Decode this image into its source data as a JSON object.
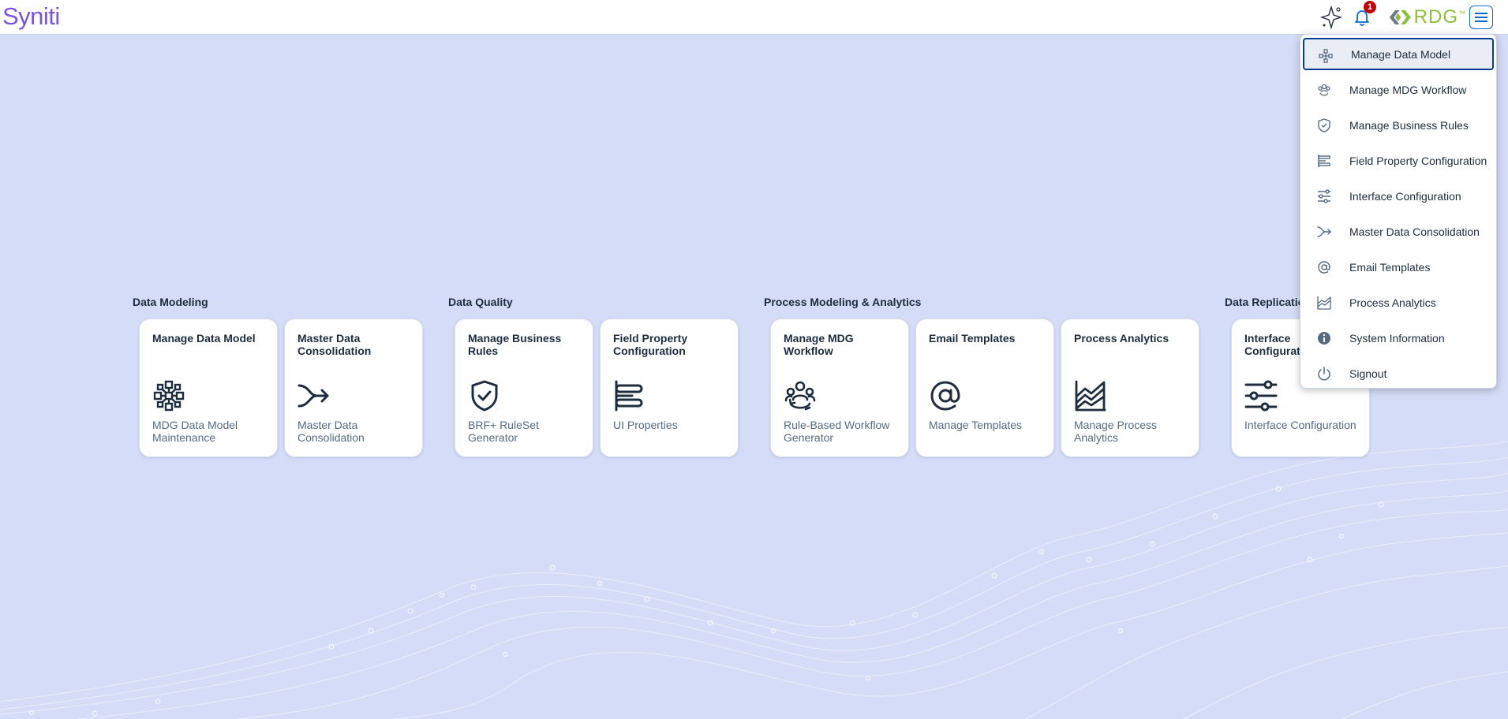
{
  "header": {
    "logo_text": "Syniti",
    "notification_count": "1",
    "rdg_text": "RDG",
    "rdg_tm": "™",
    "colors": {
      "logo": "#7a55e0",
      "rdg_green": "#8cbf3f",
      "badge": "#c00000"
    }
  },
  "groups": [
    {
      "title": "Data Modeling"
    },
    {
      "title": "Data Quality"
    },
    {
      "title": "Process Modeling & Analytics"
    },
    {
      "title": "Data Replication"
    }
  ],
  "tiles": [
    {
      "title": "Manage Data Model",
      "subtitle": "MDG Data Model Maintenance",
      "icon": "network-icon"
    },
    {
      "title": "Master Data Consolidation",
      "subtitle": "Master Data Consolidation",
      "icon": "merge-arrow-icon"
    },
    {
      "title": "Manage Business Rules",
      "subtitle": "BRF+ RuleSet Generator",
      "icon": "shield-check-icon"
    },
    {
      "title": "Field Property Configuration",
      "subtitle": "UI Properties",
      "icon": "field-bars-icon"
    },
    {
      "title": "Manage MDG Workflow",
      "subtitle": "Rule-Based Workflow Generator",
      "icon": "people-cycle-icon"
    },
    {
      "title": "Email Templates",
      "subtitle": "Manage Templates",
      "icon": "at-sign-icon"
    },
    {
      "title": "Process Analytics",
      "subtitle": "Manage Process Analytics",
      "icon": "area-chart-icon"
    },
    {
      "title": "Interface Configuration",
      "subtitle": "Interface Configuration",
      "icon": "sliders-icon"
    }
  ],
  "menu": {
    "items": [
      {
        "label": "Manage Data Model",
        "icon": "network-icon",
        "selected": true
      },
      {
        "label": "Manage MDG Workflow",
        "icon": "people-cycle-icon"
      },
      {
        "label": "Manage Business Rules",
        "icon": "shield-check-icon"
      },
      {
        "label": "Field Property Configuration",
        "icon": "field-bars-icon"
      },
      {
        "label": "Interface Configuration",
        "icon": "sliders-icon"
      },
      {
        "label": "Master Data Consolidation",
        "icon": "merge-arrow-icon"
      },
      {
        "label": "Email Templates",
        "icon": "at-sign-icon"
      },
      {
        "label": "Process Analytics",
        "icon": "area-chart-icon"
      },
      {
        "label": "System Information",
        "icon": "info-icon"
      },
      {
        "label": "Signout",
        "icon": "power-icon"
      }
    ]
  }
}
